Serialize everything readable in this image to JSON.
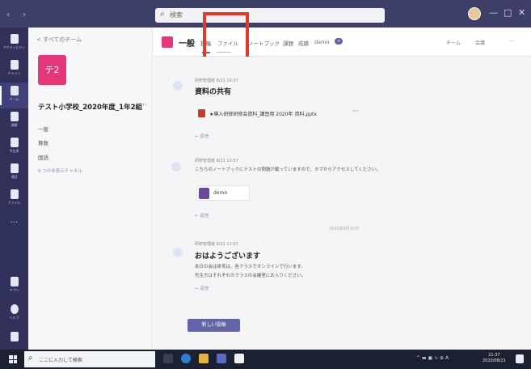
{
  "titlebar": {
    "nav": "‹ ›",
    "search_placeholder": "検索",
    "window_buttons": [
      "—",
      "□",
      "✕"
    ]
  },
  "rail": {
    "items": [
      {
        "label": "アクティビティ",
        "icon": "bell-icon"
      },
      {
        "label": "チャット",
        "icon": "chat-icon"
      },
      {
        "label": "チーム",
        "icon": "teams-icon"
      },
      {
        "label": "課題",
        "icon": "assignments-icon"
      },
      {
        "label": "予定表",
        "icon": "calendar-icon"
      },
      {
        "label": "通話",
        "icon": "phone-icon"
      },
      {
        "label": "ファイル",
        "icon": "files-icon"
      },
      {
        "label": "アプリ",
        "icon": "apps-icon"
      },
      {
        "label": "ヘルプ",
        "icon": "help-icon"
      }
    ]
  },
  "team": {
    "back_label": "< すべてのチーム",
    "avatar_text": "テ2",
    "name": "テスト小学校_2020年度_1年2組",
    "more": "···",
    "channels": [
      "一般",
      "算数",
      "国語"
    ],
    "hidden_channels": "9 つの非表示チャネル"
  },
  "channel": {
    "title": "一般",
    "tabs": [
      "投稿",
      "ファイル",
      "ノートブック",
      "課題",
      "成績",
      "demo"
    ],
    "badge": "+",
    "right_items": [
      "チーム",
      "会議",
      "···"
    ]
  },
  "posts": [
    {
      "meta": "研修管理者  8/21 10:37",
      "title": "資料の共有",
      "file": "★導入研修研修会資料_講習用  2020年 資料.pptx",
      "file_more": "···",
      "reply": "← 返信"
    },
    {
      "meta": "研修管理者  8/21 10:57",
      "text": "こちらのノートブックにテストの問題が載っていますので、タブからアクセスしてください。",
      "card": "demo",
      "reply": "← 返信"
    },
    {
      "date_separator": "2020年8月21日",
      "meta": "研修管理者  8/21 11:07",
      "title": "おはようございます",
      "lines": [
        "本日の会は体育は、各クラスでオンラインで行います。",
        "先生方はそれぞれのクラスの会議室にお入りください。"
      ],
      "reply": "← 返信"
    }
  ],
  "new_post_button": "新しい投稿",
  "taskbar": {
    "search_placeholder": "ここに入力して検索",
    "tray": "^  ▬  ▣  ∿  ⊕  A",
    "time": "11:37",
    "date": "2020/08/21"
  }
}
